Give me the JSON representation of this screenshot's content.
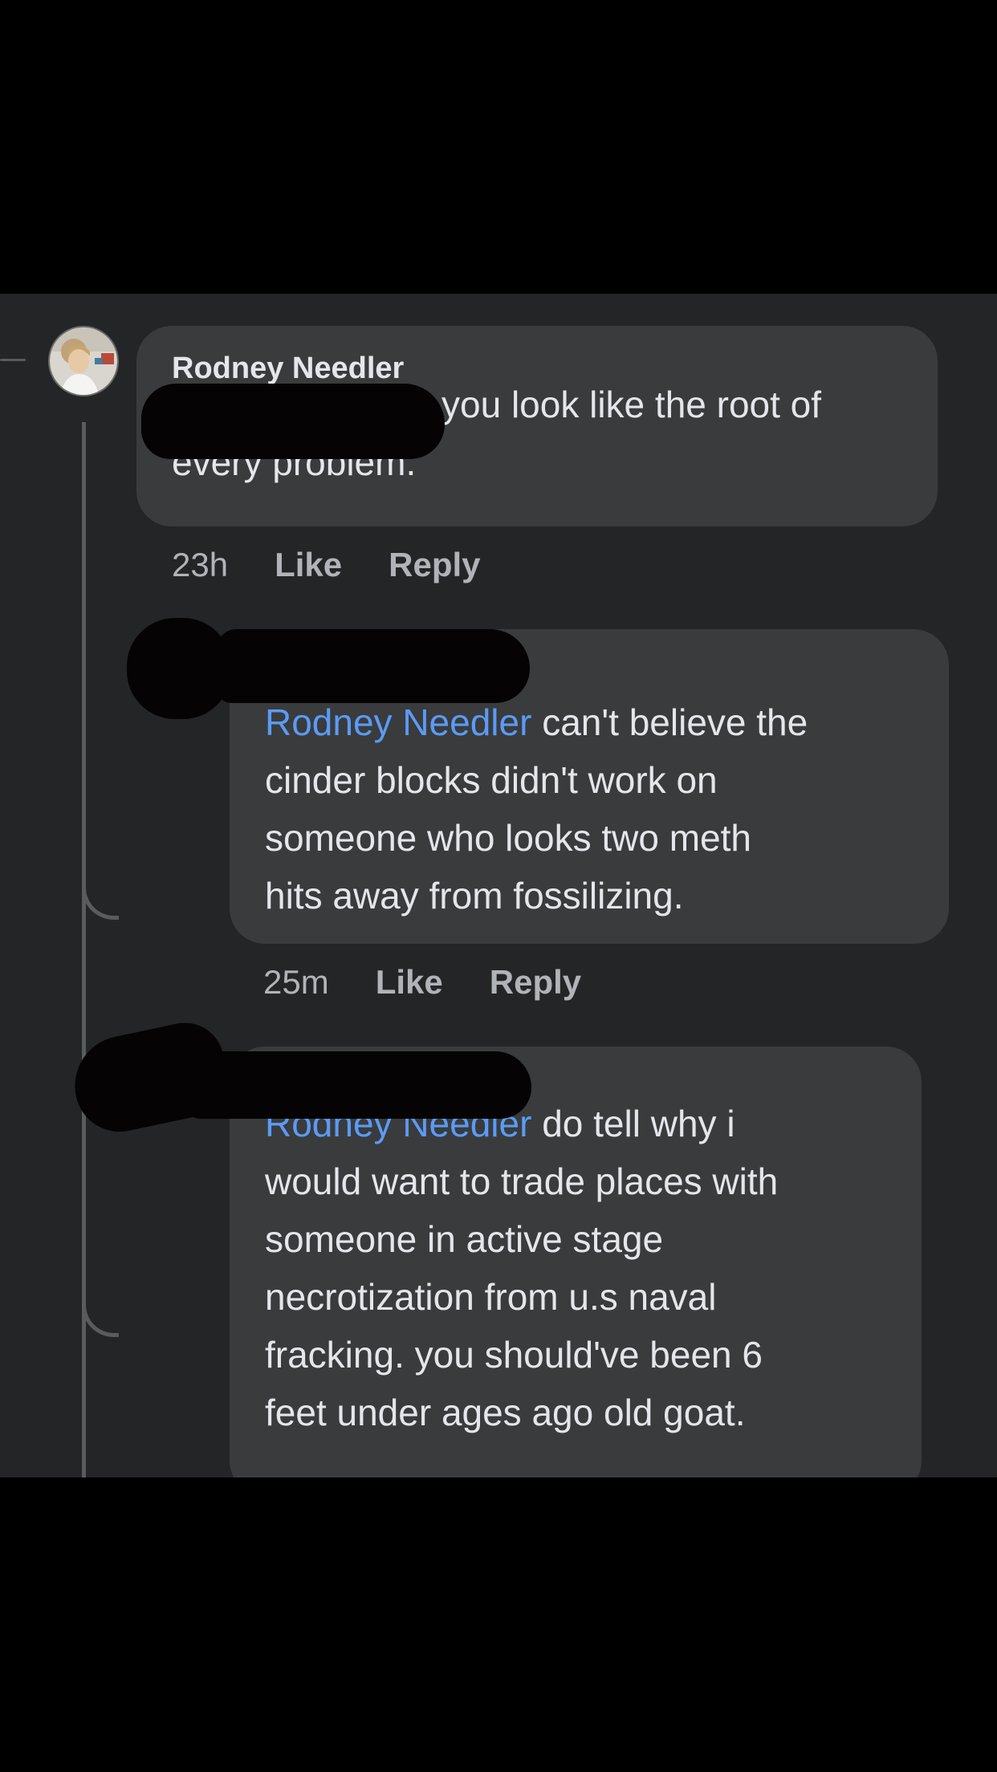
{
  "comments": [
    {
      "author": "Rodney Needler",
      "text_line1": "you look like the root of",
      "text_line2": "every problem.",
      "time": "23h",
      "like_label": "Like",
      "reply_label": "Reply"
    },
    {
      "mention": "Rodney Needler",
      "text_after_mention": " can't believe the",
      "text_lines": [
        "cinder blocks didn't work on",
        "someone who looks two meth",
        "hits away from fossilizing."
      ],
      "time": "25m",
      "like_label": "Like",
      "reply_label": "Reply"
    },
    {
      "mention": "Rodney Needler",
      "text_after_mention": " do tell why i",
      "text_lines": [
        "would want to trade places with",
        "someone in active stage",
        "necrotization from u.s naval",
        "fracking. you should've been 6",
        "feet under ages ago old goat."
      ]
    }
  ],
  "colors": {
    "background": "#000000",
    "thread_background": "#242526",
    "bubble": "#3a3b3c",
    "text": "#e4e6eb",
    "mention": "#5a9bf6",
    "meta": "#b0b3b8"
  }
}
